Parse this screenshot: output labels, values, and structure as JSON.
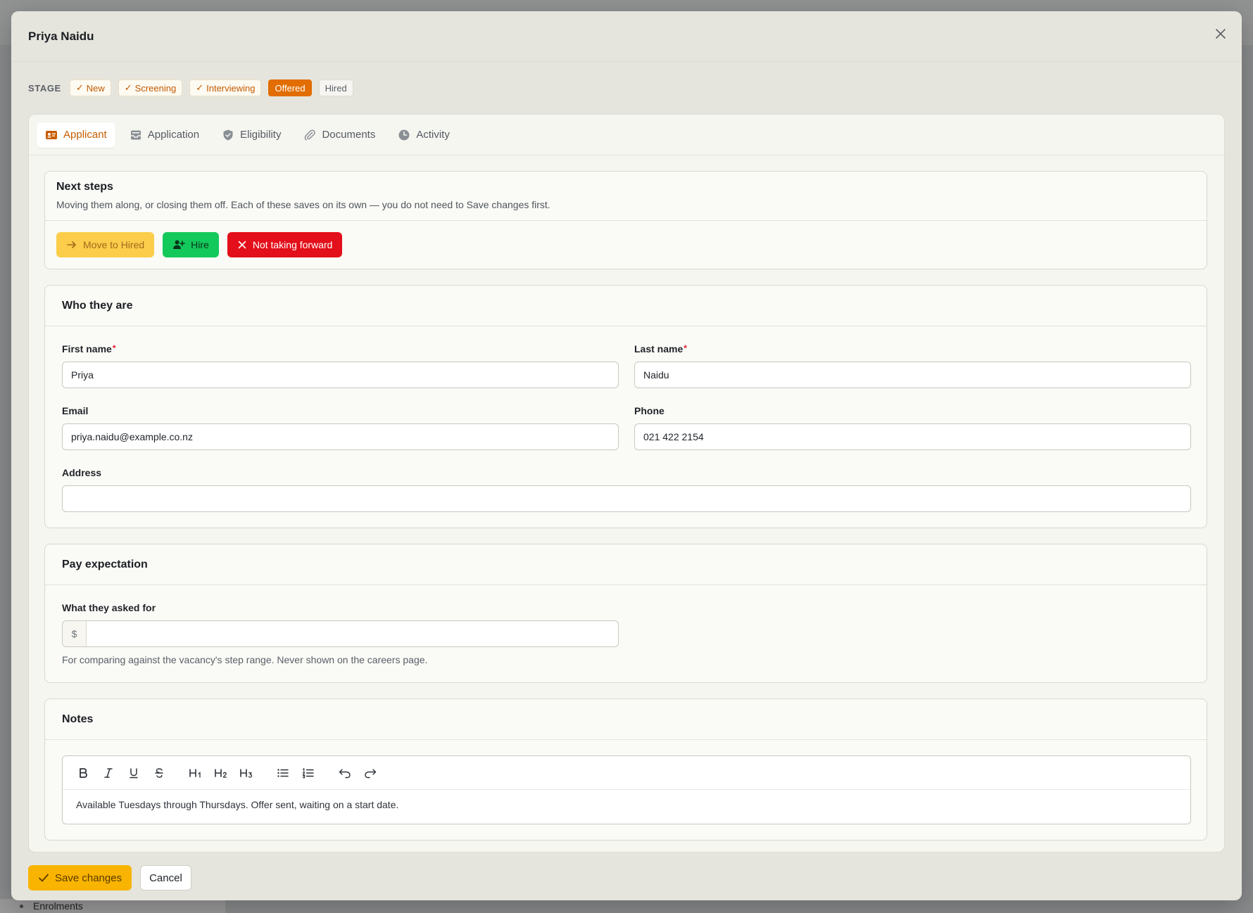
{
  "backdrop": {
    "nav_item": "Enrolments"
  },
  "modal": {
    "title": "Priya Naidu"
  },
  "stage": {
    "label": "STAGE",
    "steps": [
      {
        "label": "New",
        "state": "done"
      },
      {
        "label": "Screening",
        "state": "done"
      },
      {
        "label": "Interviewing",
        "state": "done"
      },
      {
        "label": "Offered",
        "state": "current"
      },
      {
        "label": "Hired",
        "state": "future"
      }
    ],
    "check_glyph": "✓"
  },
  "tabs": [
    {
      "label": "Applicant",
      "icon": "id-card-icon",
      "active": true
    },
    {
      "label": "Application",
      "icon": "inbox-icon",
      "active": false
    },
    {
      "label": "Eligibility",
      "icon": "shield-icon",
      "active": false
    },
    {
      "label": "Documents",
      "icon": "paperclip-icon",
      "active": false
    },
    {
      "label": "Activity",
      "icon": "clock-icon",
      "active": false
    }
  ],
  "next_steps": {
    "title": "Next steps",
    "description": "Moving them along, or closing them off. Each of these saves on its own — you do not need to Save changes first.",
    "move_label": "Move to Hired",
    "hire_label": "Hire",
    "reject_label": "Not taking forward"
  },
  "who": {
    "title": "Who they are",
    "first_name": {
      "label": "First name",
      "value": "Priya",
      "required": "*"
    },
    "last_name": {
      "label": "Last name",
      "value": "Naidu",
      "required": "*"
    },
    "email": {
      "label": "Email",
      "value": "priya.naidu@example.co.nz"
    },
    "phone": {
      "label": "Phone",
      "value": "021 422 2154"
    },
    "address": {
      "label": "Address",
      "value": ""
    }
  },
  "pay": {
    "title": "Pay expectation",
    "label": "What they asked for",
    "prefix": "$",
    "value": "",
    "hint": "For comparing against the vacancy's step range. Never shown on the careers page."
  },
  "notes": {
    "title": "Notes",
    "toolbar": [
      "bold",
      "italic",
      "underline",
      "strikethrough",
      "heading-1",
      "heading-2",
      "heading-3",
      "bullet-list",
      "ordered-list",
      "undo",
      "redo"
    ],
    "content": "Available Tuesdays through Thursdays. Offer sent, waiting on a start date."
  },
  "footer": {
    "save_label": "Save changes",
    "cancel_label": "Cancel"
  },
  "colors": {
    "accent": "#e26d00",
    "save": "#f8b400",
    "hire": "#14c95b",
    "reject": "#e30f1a",
    "move": "#fbcd4a"
  }
}
